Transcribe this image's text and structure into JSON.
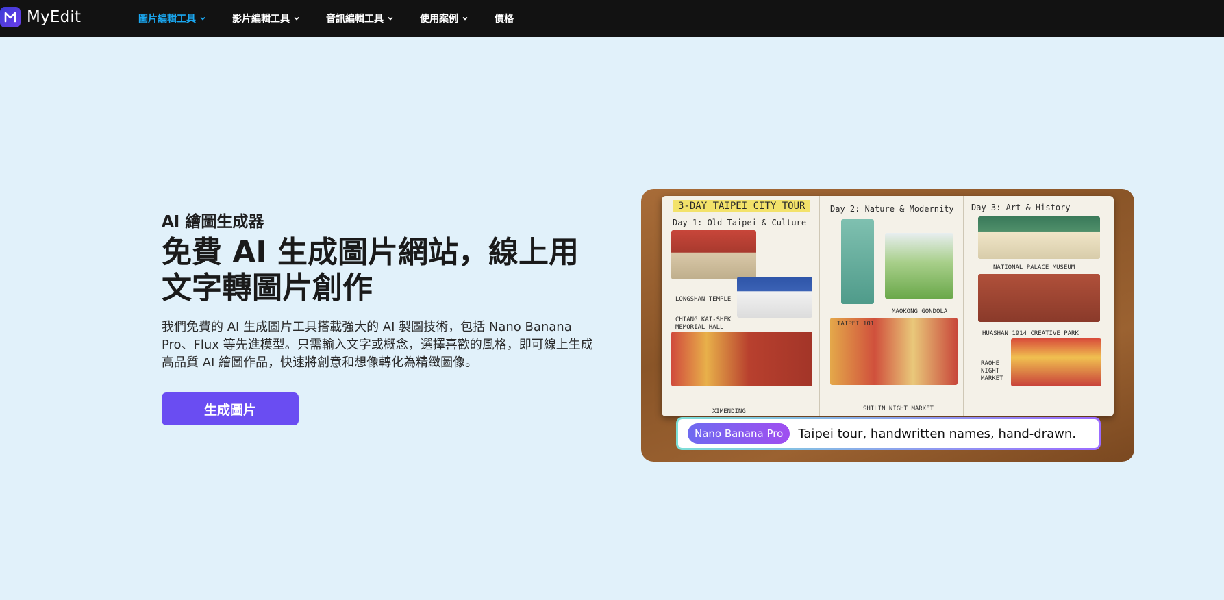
{
  "nav": {
    "brand": "MyEdit",
    "items": [
      {
        "label": "圖片編輯工具",
        "active": true,
        "has_dropdown": true
      },
      {
        "label": "影片編輯工具",
        "active": false,
        "has_dropdown": true
      },
      {
        "label": "音訊編輯工具",
        "active": false,
        "has_dropdown": true
      },
      {
        "label": "使用案例",
        "active": false,
        "has_dropdown": true
      },
      {
        "label": "價格",
        "active": false,
        "has_dropdown": false
      }
    ]
  },
  "hero": {
    "eyebrow": "AI 繪圖生成器",
    "headline": "免費 AI 生成圖片網站，線上用文字轉圖片創作",
    "description": "我們免費的 AI 生成圖片工具搭載強大的 AI 製圖技術，包括 Nano Banana Pro、Flux 等先進模型。只需輸入文字或概念，選擇喜歡的風格，即可線上生成高品質 AI 繪圖作品，快速將創意和想像轉化為精緻圖像。",
    "cta_label": "生成圖片"
  },
  "showcase": {
    "journal_title": "3-DAY TAIPEI CITY TOUR",
    "days": [
      "Day 1: Old Taipei & Culture",
      "Day 2: Nature & Modernity",
      "Day 3: Art & History"
    ],
    "places": [
      "LONGSHAN TEMPLE",
      "CHIANG KAI-SHEK MEMORIAL HALL",
      "XIMENDING",
      "TAIPEI 101",
      "MAOKONG GONDOLA",
      "SHILIN NIGHT MARKET",
      "NATIONAL PALACE MUSEUM",
      "HUASHAN 1914 CREATIVE PARK",
      "RAOHE NIGHT MARKET"
    ],
    "model_name": "Nano Banana Pro",
    "prompt": "Taipei tour, handwritten names, hand-drawn."
  },
  "colors": {
    "nav_bg": "#121212",
    "page_bg": "#e1f1fa",
    "active_link": "#1aa7f0",
    "cta_bg": "#6a4df2"
  },
  "icons": {
    "logo": "myedit-logo-icon",
    "dropdown": "chevron-down-icon"
  }
}
